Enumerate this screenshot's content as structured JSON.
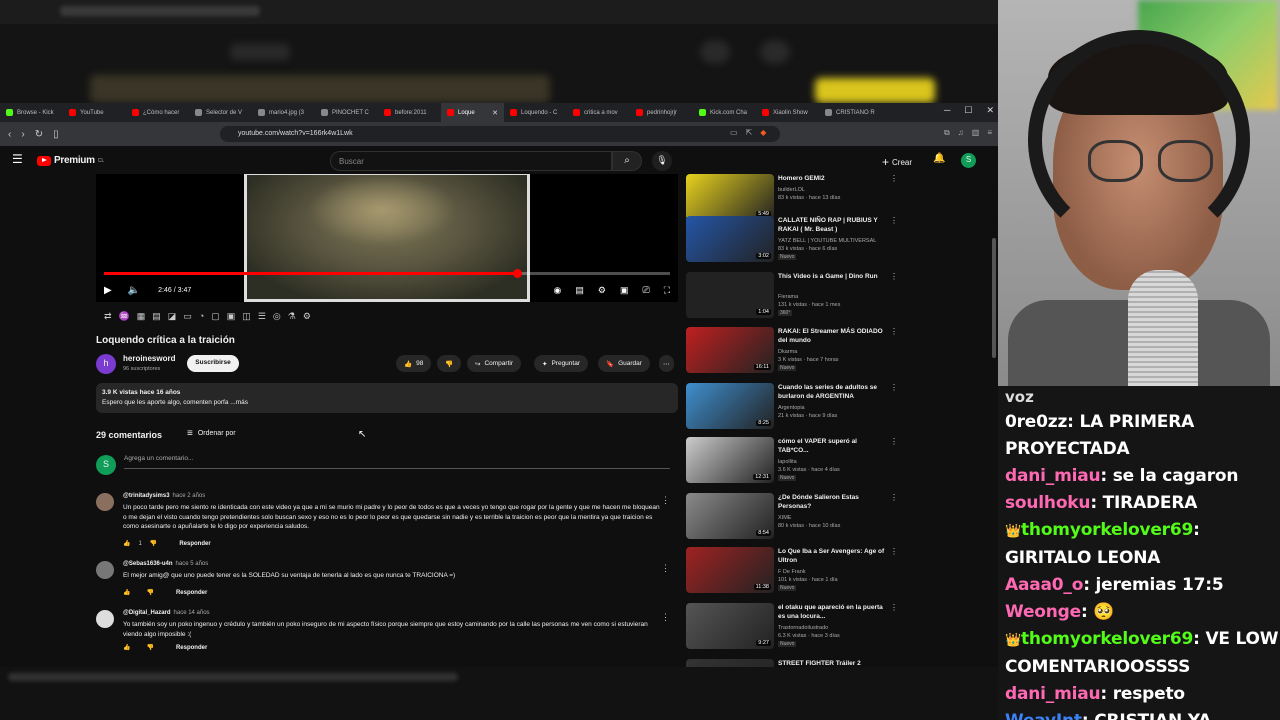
{
  "browser": {
    "tabs": [
      {
        "label": "Browse - Kick",
        "color": "#53fc18"
      },
      {
        "label": "YouTube",
        "color": "#ff0000"
      },
      {
        "label": "¿Cómo hacer",
        "color": "#ff0000"
      },
      {
        "label": "Selector de V",
        "color": "#888888"
      },
      {
        "label": "mario4.jpg (3",
        "color": "#888888"
      },
      {
        "label": "PINOCHET C",
        "color": "#888888"
      },
      {
        "label": "before:2011",
        "color": "#ff0000"
      },
      {
        "label": "Loque",
        "color": "#ff0000",
        "active": true
      },
      {
        "label": "Loquendo - C",
        "color": "#ff0000"
      },
      {
        "label": "critica a mov",
        "color": "#ff0000"
      },
      {
        "label": "pedrinhojrjr",
        "color": "#ff0000"
      },
      {
        "label": "Kick.com Cha",
        "color": "#53fc18"
      },
      {
        "label": "Xiaolin Show",
        "color": "#ff0000"
      },
      {
        "label": "CRISTIANO R",
        "color": "#888888"
      }
    ],
    "url": "youtube.com/watch?v=166rk4w1Lwk"
  },
  "yt": {
    "logo_text": "Premium",
    "logo_region": "CL",
    "search_placeholder": "Buscar",
    "create_label": "Crear",
    "avatar_letter": "S"
  },
  "player": {
    "time": "2:46 / 3:47",
    "progress": 0.73
  },
  "video": {
    "title": "Loquendo crítica a la traición",
    "channel": "heroinesword",
    "subs": "96 suscriptores",
    "channel_letter": "h",
    "subscribe_label": "Suscribirse",
    "likes": "98",
    "share_label": "Compartir",
    "ask_label": "Preguntar",
    "save_label": "Guardar",
    "desc_meta": "3.9 K vistas  hace 16 años",
    "desc_text": "Espero que les aporte algo, comenten porfa ...más"
  },
  "comments": {
    "count_label": "29 comentarios",
    "sort_label": "Ordenar por",
    "add_placeholder": "Agrega un comentario...",
    "my_letter": "S",
    "reply_label": "Responder",
    "items": [
      {
        "author": "@trinitadysims3",
        "when": "hace 2 años",
        "text": "Un poco tarde pero me siento re identicada con este video ya que a mi se murio mi padre y lo peor de todos es que a veces yo tengo que rogar por la gente y que me hacen me bloquean o me dejan el visto cuando tengo pretendientes solo buscan sexo y eso no es lo peor lo peor es que quedarse sin nadie y es terrible la traicion es peor que la mentira ya que traicion es como asesinarte o apuñalarte te lo digo por experiencia saludos.",
        "likes": "1",
        "color": "#8a6f5e"
      },
      {
        "author": "@Sebas1636-u4n",
        "when": "hace 5 años",
        "text": "El mejor amig@ que uno puede tener es la SOLEDAD su ventaja de tenerla al lado es que nunca te TRAICIONA =)",
        "likes": "",
        "color": "#777777"
      },
      {
        "author": "@Digital_Hazard",
        "when": "hace 14 años",
        "text": "Yo también soy un poko ingenuo y crédulo y también un poko inseguro de mi aspecto físico porque siempre que estoy caminando por la calle las personas me ven como si estuvieran viendo algo imposible :(",
        "likes": "",
        "color": "#dddddd"
      }
    ]
  },
  "sidebar": [
    {
      "title": "Homero GEMI2",
      "channel": "builderLOL",
      "meta": "83 k vistas · hace 13 días",
      "duration": "5:49",
      "new": false,
      "thumb": "#e8d21d"
    },
    {
      "title": "CALLATE NIÑO RAP | RUBIUS Y RAKAI ( Mr. Beast )",
      "channel": "YATZ BELL | YOUTUBE MULTIVERSAL",
      "meta": "83 k vistas · hace 6 días",
      "duration": "3:02",
      "new": true,
      "thumb": "#2456a8"
    },
    {
      "title": "This Video is a Game | Dino Run",
      "channel": "Fierama",
      "meta": "131 k vistas · hace 1 mes",
      "duration": "1:04",
      "new": false,
      "badge": "360°",
      "thumb": "#222222"
    },
    {
      "title": "RAKAI: El Streamer MÁS ODIADO del mundo",
      "channel": "Dkarma",
      "meta": "3 K vistas · hace 7 horas",
      "duration": "16:11",
      "new": true,
      "thumb": "#c02020"
    },
    {
      "title": "Cuando las series de adultos se burlaron de ARGENTINA",
      "channel": "Argentopia",
      "meta": "21 k vistas · hace 9 días",
      "duration": "8:25",
      "new": false,
      "thumb": "#3f8fcf"
    },
    {
      "title": "cómo el VAPER superó al TAB*CO...",
      "channel": "lapollita",
      "meta": "3.6 K vistas · hace 4 días",
      "duration": "12:31",
      "new": true,
      "thumb": "#cccccc"
    },
    {
      "title": "¿De Dónde Salieron Estas Personas?",
      "channel": "XIME",
      "meta": "80 k vistas · hace 10 días",
      "duration": "8:54",
      "new": false,
      "thumb": "#8a8a8a"
    },
    {
      "title": "Lo Que Iba a Ser Avengers: Age of Ultron",
      "channel": "F De Frank",
      "meta": "101 k vistas · hace 1 día",
      "duration": "11:38",
      "new": true,
      "thumb": "#a02222"
    },
    {
      "title": "el otaku que apareció en la puerta es una locura...",
      "channel": "Trastornadoilustrado",
      "meta": "6.3 K vistas · hace 3 días",
      "duration": "9:27",
      "new": true,
      "thumb": "#555555"
    },
    {
      "title": "STREET FIGHTER Tráiler 2",
      "channel": "",
      "meta": "",
      "duration": "",
      "new": false,
      "thumb": "#333333"
    }
  ],
  "sidebar_labels": {
    "new_label": "Nuevo"
  },
  "chat": {
    "header": "voz",
    "messages": [
      {
        "user": "0re0zz",
        "text": "LA PRIMERA PROYECTADA",
        "color": "#ffffff",
        "badge": false
      },
      {
        "user": "dani_miau",
        "text": "se la cagaron",
        "color": "#ff69b4",
        "badge": false
      },
      {
        "user": "soulhoku",
        "text": "TIRADERA",
        "color": "#ff69b4",
        "badge": false
      },
      {
        "user": "thomyorkelover69",
        "text": "GIRITALO LEONA",
        "color": "#53fc18",
        "badge": true
      },
      {
        "user": "Aaaa0_o",
        "text": "jeremias 17:5",
        "color": "#ff69b4",
        "badge": false
      },
      {
        "user": "Weonge",
        "text": "🥺",
        "color": "#ff69b4",
        "badge": false
      },
      {
        "user": "thomyorkelover69",
        "text": "VE LOW COMENTARIOOSSSS",
        "color": "#53fc18",
        "badge": true
      },
      {
        "user": "dani_miau",
        "text": "respeto",
        "color": "#ff69b4",
        "badge": false
      },
      {
        "user": "WeayInt",
        "text": "CRISTIAN YA",
        "color": "#3b82f6",
        "badge": false
      }
    ]
  }
}
